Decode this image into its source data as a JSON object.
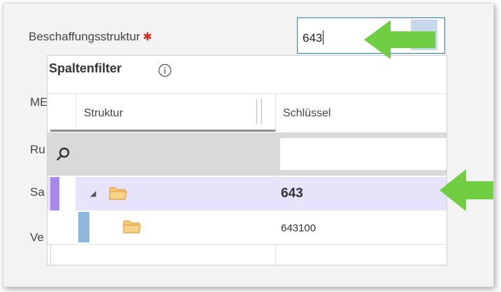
{
  "field": {
    "label": "Beschaffungsstruktur",
    "required_mark": "✱",
    "value": "643"
  },
  "background_labels": [
    "ME",
    "Ru",
    "Sa",
    "Ve"
  ],
  "popup": {
    "title": "Spaltenfilter",
    "columns": {
      "struktur": "Struktur",
      "schluessel": "Schlüssel"
    },
    "rows": [
      {
        "key": "643",
        "selected": true,
        "level": 0,
        "expanded": true
      },
      {
        "key": "643100",
        "selected": false,
        "level": 1,
        "expanded": false
      }
    ]
  },
  "colors": {
    "accent": "#2c7bc9",
    "selected_row": "#e7e3fb",
    "selected_marker": "#a889ea",
    "child_marker": "#8fb7d9",
    "folder": "#f2b45a",
    "arrow": "#6fce41"
  },
  "icons": [
    "info-icon",
    "search-icon",
    "expand-triangle-icon",
    "folder-icon",
    "arrow-left-icon"
  ]
}
